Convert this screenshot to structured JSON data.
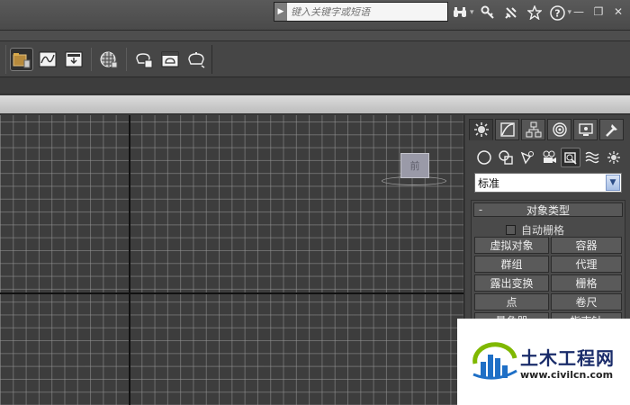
{
  "search": {
    "placeholder": "键入关键字或短语"
  },
  "title_icons": [
    "binoculars-icon",
    "key-icon",
    "satellite-icon",
    "star-icon",
    "help-icon"
  ],
  "window_controls": {
    "minimize": "—",
    "restore": "❐",
    "close": "✕"
  },
  "toolbar": {
    "tools": [
      "scene-explorer-icon",
      "curve-editor-icon",
      "render-setup-icon",
      "material-editor-icon",
      "render-frame-icon",
      "render-production-icon",
      "render-iterative-icon"
    ]
  },
  "viewport": {
    "viewcube_label": "前"
  },
  "command_panel": {
    "tabs": [
      "create-tab",
      "modify-tab",
      "hierarchy-tab",
      "motion-tab",
      "display-tab",
      "utilities-tab"
    ],
    "subtabs": [
      "geometry",
      "shapes",
      "lights",
      "cameras",
      "helpers",
      "space-warps",
      "systems"
    ],
    "dropdown_value": "标准",
    "rollout": {
      "title": "对象类型",
      "toggle": "-",
      "autogrid_label": "自动栅格",
      "buttons": [
        "虚拟对象",
        "容器",
        "群组",
        "代理",
        "露出变换",
        "栅格",
        "点",
        "卷尺",
        "量角器",
        "指南针"
      ]
    }
  },
  "watermark": {
    "brand": "土木工程网",
    "url": "www.civilcn.com"
  },
  "colors": {
    "accent_blue": "#1a2c6a",
    "viewport_bg": "#3d3d3d"
  }
}
